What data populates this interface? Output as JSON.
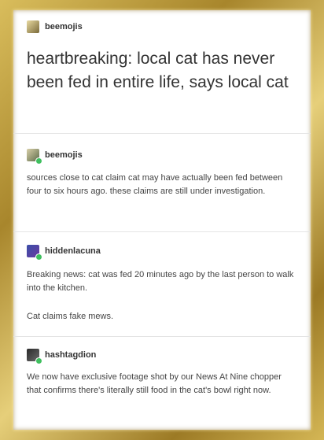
{
  "posts": [
    {
      "username": "beemojis",
      "text": "heartbreaking: local cat has never been fed in entire life, says local cat",
      "icon": "bee-avatar-icon"
    },
    {
      "username": "beemojis",
      "text": "sources close to cat claim cat may have actually been fed between four to six hours ago. these claims are still under investigation.",
      "icon": "bee-avatar-icon"
    },
    {
      "username": "hiddenlacuna",
      "paragraphs": [
        "Breaking news: cat was fed 20 minutes ago by the last person to walk into the kitchen.",
        "Cat claims fake mews."
      ],
      "icon": "user-avatar-icon"
    },
    {
      "username": "hashtagdion",
      "text": "We now have exclusive footage shot by our News At Nine chopper that confirms there's literally still food in the cat's bowl right now.",
      "icon": "user-avatar-icon"
    }
  ]
}
